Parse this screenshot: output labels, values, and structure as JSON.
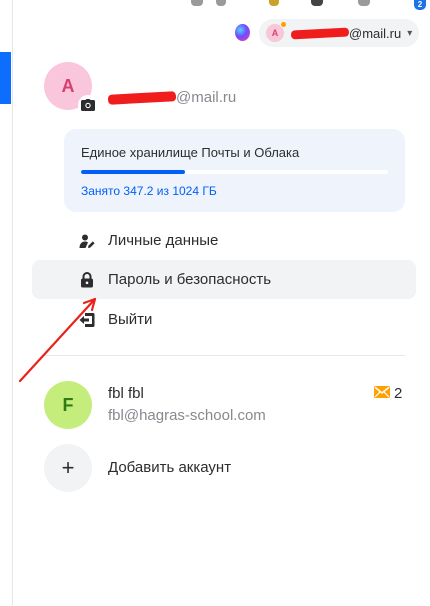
{
  "header": {
    "account_chip": {
      "avatar_letter": "A",
      "email_suffix": "@mail.ru",
      "chevron": "▾"
    },
    "assistant_icon": "marusia-icon"
  },
  "top_bar": {
    "notification_badge": "2"
  },
  "profile": {
    "avatar_letter": "A",
    "name": "",
    "email_suffix": "@mail.ru",
    "camera_icon": "camera-icon"
  },
  "storage": {
    "title": "Единое хранилище Почты и Облака",
    "used_text": "Занято 347.2 из 1024 ГБ",
    "used_fraction": 0.339,
    "bar_color": "#005ff9"
  },
  "menu": {
    "items": [
      {
        "label": "Личные данные",
        "icon": "user-edit-icon"
      },
      {
        "label": "Пароль и безопасность",
        "icon": "lock-icon",
        "active": true
      },
      {
        "label": "Выйти",
        "icon": "logout-icon"
      }
    ]
  },
  "accounts": [
    {
      "avatar_letter": "F",
      "name": "fbl fbl",
      "email": "fbl@hagras-school.com",
      "unread_icon": "envelope-icon",
      "unread_count": "2"
    }
  ],
  "add_account": {
    "icon": "+",
    "label": "Добавить аккаунт"
  },
  "colors": {
    "accent": "#005ff9",
    "annotation": "#e8231b",
    "redaction": "#f01d1d"
  }
}
